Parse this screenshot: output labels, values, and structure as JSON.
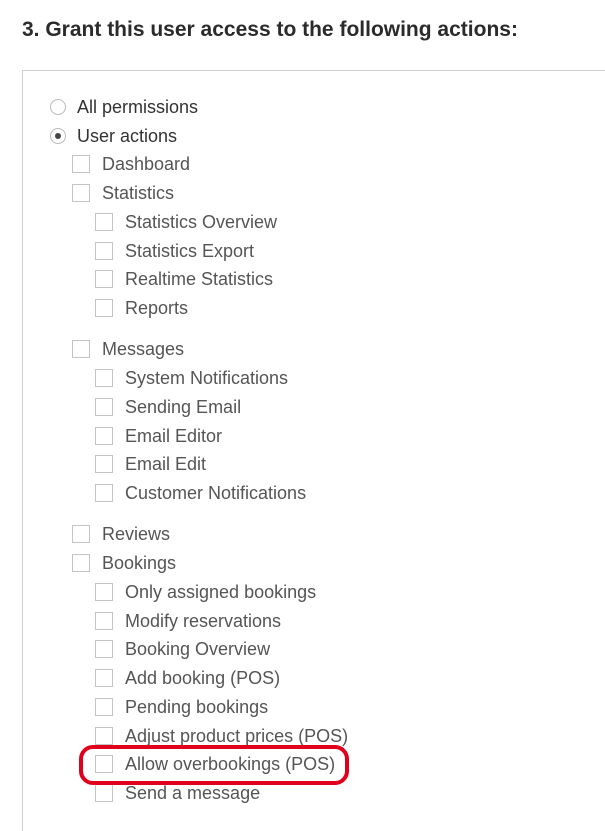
{
  "heading": "3. Grant this user access to the following actions:",
  "permission_mode": {
    "options": [
      "All permissions",
      "User actions"
    ],
    "selected": "User actions"
  },
  "groups": [
    {
      "label": "Dashboard",
      "checked": false,
      "children": []
    },
    {
      "label": "Statistics",
      "checked": false,
      "children": [
        "Statistics Overview",
        "Statistics Export",
        "Realtime Statistics",
        "Reports"
      ]
    },
    {
      "label": "Messages",
      "checked": false,
      "children": [
        "System Notifications",
        "Sending Email",
        "Email Editor",
        "Email Edit",
        "Customer Notifications"
      ]
    },
    {
      "label": "Reviews",
      "checked": false,
      "children": []
    },
    {
      "label": "Bookings",
      "checked": false,
      "children": [
        "Only assigned bookings",
        "Modify reservations",
        "Booking Overview",
        "Add booking (POS)",
        "Pending bookings",
        "Adjust product prices (POS)",
        "Allow overbookings (POS)",
        "Send a message"
      ]
    }
  ],
  "highlighted_item": "Allow overbookings (POS)",
  "colors": {
    "highlight": "#e0001b",
    "text": "#555555",
    "heading": "#2b2b2b"
  }
}
